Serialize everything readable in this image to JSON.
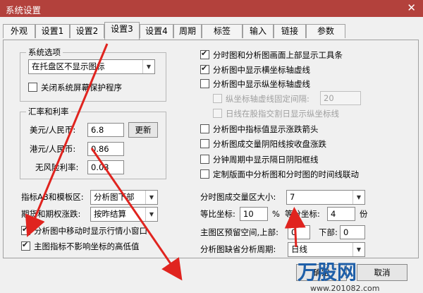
{
  "window": {
    "title": "系统设置",
    "close": "✕"
  },
  "tabs": [
    {
      "label": "外观",
      "active": false
    },
    {
      "label": "设置1",
      "active": false
    },
    {
      "label": "设置2",
      "active": false
    },
    {
      "label": "设置3",
      "active": true
    },
    {
      "label": "设置4",
      "active": false
    },
    {
      "label": "周期",
      "active": false
    },
    {
      "label": "标签",
      "active": false
    },
    {
      "label": "输入",
      "active": false
    },
    {
      "label": "链接",
      "active": false
    },
    {
      "label": "参数",
      "active": false
    }
  ],
  "system_options": {
    "title": "系统选项",
    "tray_select": "在托盘区不显示图标",
    "close_screensaver": {
      "label": "关闭系统屏幕保护程序",
      "checked": false
    }
  },
  "exchange": {
    "title": "汇率和利率",
    "usd_label": "美元/人民币:",
    "usd_value": "6.8",
    "update_button": "更新",
    "hkd_label": "港元/人民币:",
    "hkd_value": "0.86",
    "riskfree_label": "无风险利率:",
    "riskfree_value": "0.03"
  },
  "indicator_ab": {
    "label": "指标AB和模板区:",
    "value": "分析图下部"
  },
  "futures": {
    "label": "期货和期权涨跌:",
    "value": "按昨结算"
  },
  "left_checks": [
    {
      "label": "分析图中移动时显示行情小窗口",
      "checked": true
    },
    {
      "label": "主图指标不影响坐标的高低值",
      "checked": true
    }
  ],
  "right_checks": [
    {
      "label": "分时图和分析图画面上部显示工具条",
      "checked": true,
      "disabled": false
    },
    {
      "label": "分析图中显示横坐标轴虚线",
      "checked": true,
      "disabled": false
    },
    {
      "label": "分析图中显示纵坐标轴虚线",
      "checked": false,
      "disabled": false
    },
    {
      "label": "纵坐标轴虚线固定间隔:",
      "checked": false,
      "disabled": true
    },
    {
      "label": "日线在股指交割日显示纵坐标线",
      "checked": false,
      "disabled": true
    },
    {
      "label": "分析图中指标值显示涨跌箭头",
      "checked": false,
      "disabled": false
    },
    {
      "label": "分析图成交量阴阳线按收盘涨跌",
      "checked": false,
      "disabled": false
    },
    {
      "label": "分钟周期中显示隔日阴阳框线",
      "checked": false,
      "disabled": false
    },
    {
      "label": "定制版面中分析图和分时图的时间线联动",
      "checked": false,
      "disabled": false
    }
  ],
  "fixed_interval_value": "20",
  "volume_area": {
    "label": "分时图成交量区大小:",
    "value": "7"
  },
  "ratio_axis": {
    "label": "等比坐标:",
    "value": "10",
    "unit": "%"
  },
  "equal_axis": {
    "label": "等分坐标:",
    "value": "4",
    "unit": "份"
  },
  "reserve_space": {
    "label": "主图区预留空间,上部:",
    "top_value": "0",
    "bottom_label": "下部:",
    "bottom_value": "0"
  },
  "default_period": {
    "label": "分析图缺省分析周期:",
    "value": "日线"
  },
  "buttons": {
    "ok": "确定",
    "cancel": "取消"
  },
  "watermark": {
    "logo": "万股网",
    "url": "www.201082.com"
  }
}
